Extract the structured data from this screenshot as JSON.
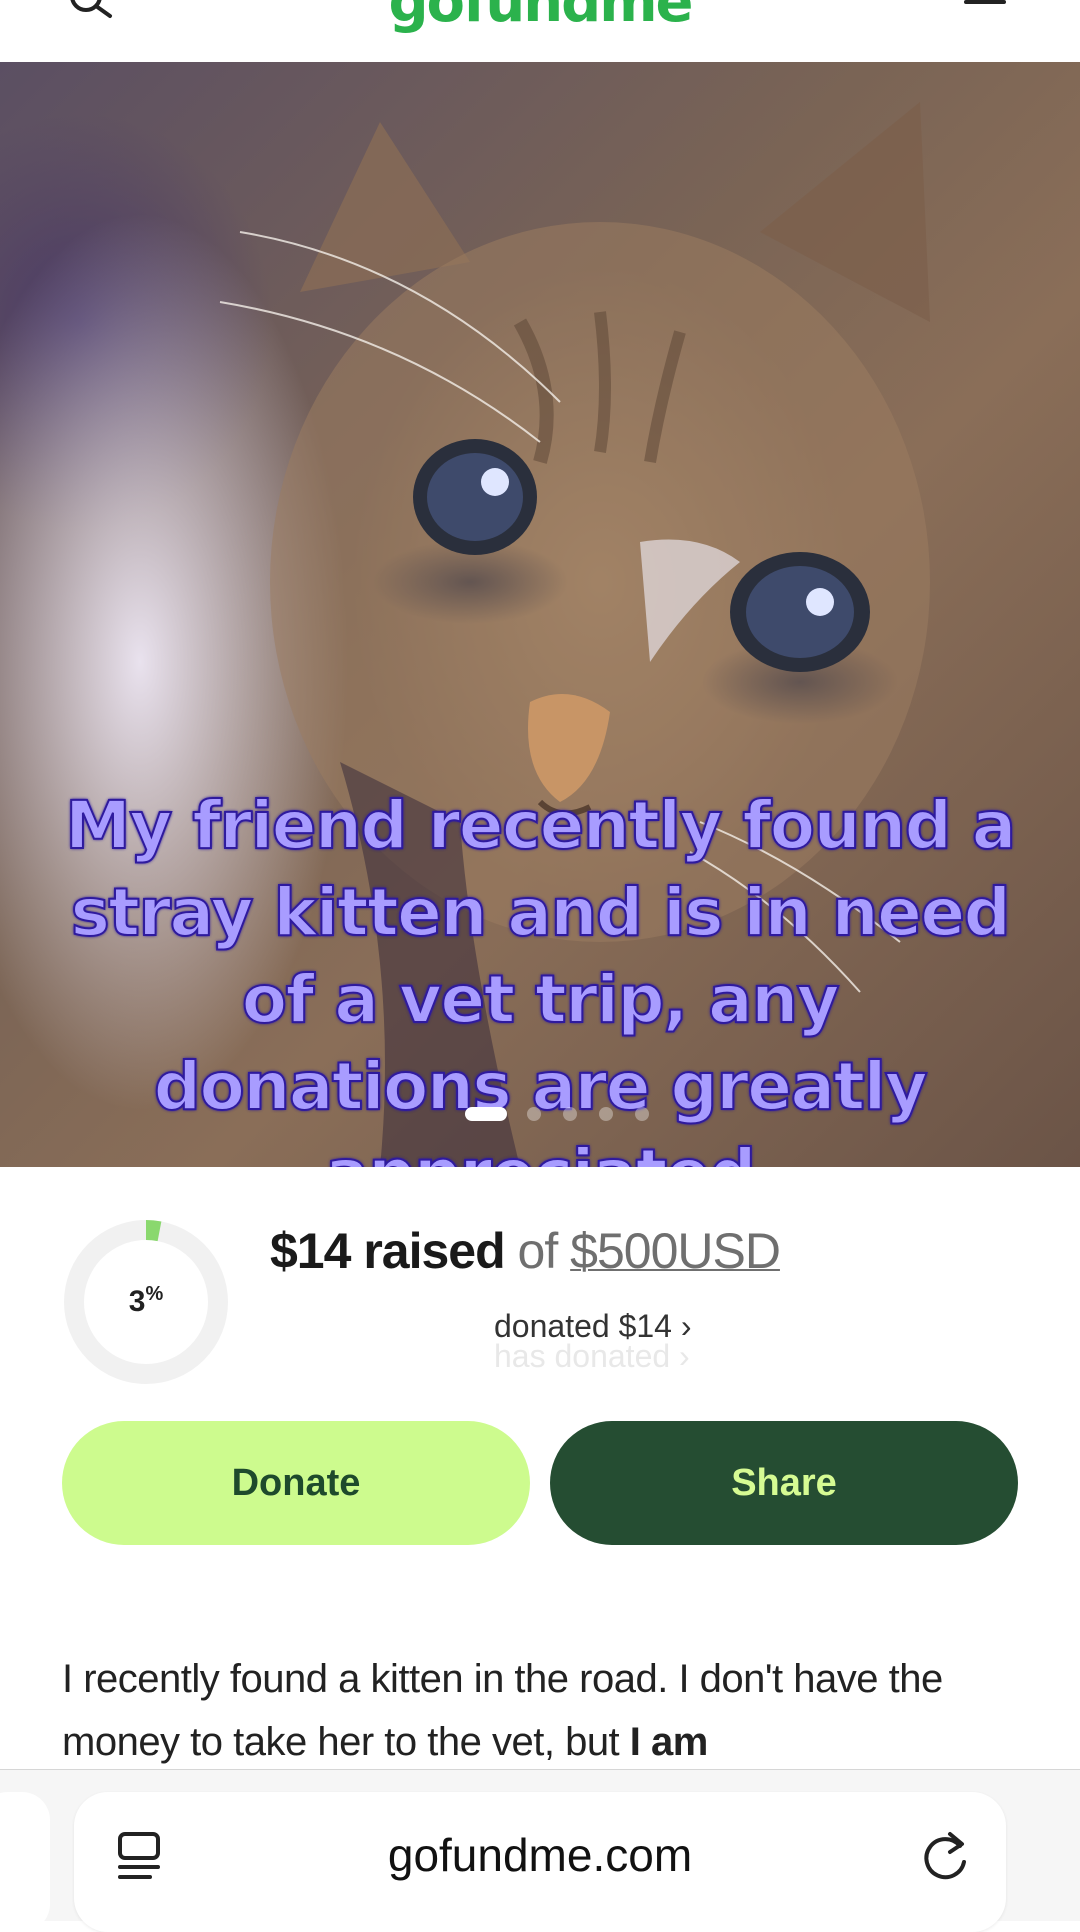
{
  "header": {
    "logo": "gofundme",
    "search_icon": "search-icon",
    "menu_icon": "hamburger-menu-icon"
  },
  "hero": {
    "caption": "My friend recently found a stray kitten and is in need of a vet trip, any donations are greatly appreciated",
    "carousel": {
      "total": 5,
      "active_index": 0
    }
  },
  "progress": {
    "percent_number": "3",
    "percent_sign": "%",
    "percent_value": 3,
    "raised_amount": "$14 raised",
    "of_text": "of",
    "goal": "$500USD",
    "donated_text": "donated $14 ›",
    "ghost_text": "has donated ›",
    "ring_color": "#8ad86e",
    "track_color": "#f1f1f1"
  },
  "buttons": {
    "donate_label": "Donate",
    "share_label": "Share"
  },
  "story": {
    "text_plain": "I recently found a kitten in the road. I don't have the money to take her to the vet, but ",
    "text_bold": "I am"
  },
  "browser": {
    "url": "gofundme.com",
    "reader_icon": "reader-mode-icon",
    "reload_icon": "reload-icon"
  },
  "colors": {
    "brand_green": "#2bb24c",
    "donate_bg": "#cdfb8e",
    "share_bg": "#254d32",
    "caption_fill": "#a89cff",
    "caption_stroke": "#2e1a9e"
  }
}
